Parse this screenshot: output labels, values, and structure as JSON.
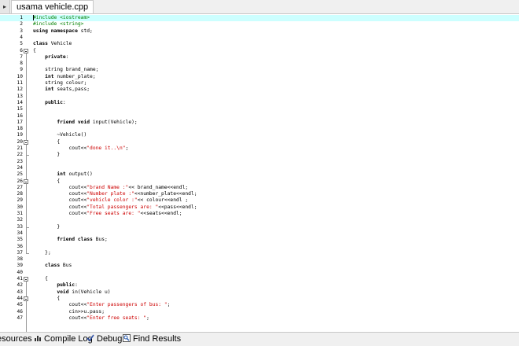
{
  "tab_bar": {
    "file_tab": "usama vehicle.cpp",
    "scroll_glyph": "▸"
  },
  "editor": {
    "lines": [
      {
        "n": "1",
        "t": [
          [
            "#include <iostream>",
            "pp"
          ]
        ]
      },
      {
        "n": "2",
        "t": [
          [
            "#include <string>",
            "pp"
          ]
        ]
      },
      {
        "n": "3",
        "t": [
          [
            "using namespace",
            "kw"
          ],
          [
            " std;",
            ""
          ]
        ]
      },
      {
        "n": "4",
        "t": []
      },
      {
        "n": "5",
        "t": [
          [
            "class",
            "kw"
          ],
          [
            " Vehicle",
            ""
          ]
        ]
      },
      {
        "n": "6",
        "t": [
          [
            "{",
            ""
          ]
        ]
      },
      {
        "n": "7",
        "t": [
          [
            "    ",
            ""
          ],
          [
            "private",
            "kw"
          ],
          [
            ":",
            ""
          ]
        ]
      },
      {
        "n": "8",
        "t": []
      },
      {
        "n": "9",
        "t": [
          [
            "    string brand_name;",
            ""
          ]
        ]
      },
      {
        "n": "10",
        "t": [
          [
            "    ",
            ""
          ],
          [
            "int",
            "kw"
          ],
          [
            " number_plate;",
            ""
          ]
        ]
      },
      {
        "n": "11",
        "t": [
          [
            "    string colour;",
            ""
          ]
        ]
      },
      {
        "n": "12",
        "t": [
          [
            "    ",
            ""
          ],
          [
            "int",
            "kw"
          ],
          [
            " seats,pass;",
            ""
          ]
        ]
      },
      {
        "n": "13",
        "t": []
      },
      {
        "n": "14",
        "t": [
          [
            "    ",
            ""
          ],
          [
            "public",
            "kw"
          ],
          [
            ":",
            ""
          ]
        ]
      },
      {
        "n": "15",
        "t": []
      },
      {
        "n": "16",
        "t": []
      },
      {
        "n": "17",
        "t": [
          [
            "        ",
            ""
          ],
          [
            "friend void",
            "kw"
          ],
          [
            " input(Vehicle);",
            ""
          ]
        ]
      },
      {
        "n": "18",
        "t": []
      },
      {
        "n": "19",
        "t": [
          [
            "        ~Vehicle()",
            ""
          ]
        ]
      },
      {
        "n": "20",
        "t": [
          [
            "        {",
            ""
          ]
        ]
      },
      {
        "n": "21",
        "t": [
          [
            "            cout<<",
            ""
          ],
          [
            "\"done it..\\n\"",
            "str"
          ],
          [
            ";",
            ""
          ]
        ]
      },
      {
        "n": "22",
        "t": [
          [
            "        }",
            ""
          ]
        ]
      },
      {
        "n": "23",
        "t": []
      },
      {
        "n": "24",
        "t": []
      },
      {
        "n": "25",
        "t": [
          [
            "        ",
            ""
          ],
          [
            "int",
            "kw"
          ],
          [
            " output()",
            ""
          ]
        ]
      },
      {
        "n": "26",
        "t": [
          [
            "        {",
            ""
          ]
        ]
      },
      {
        "n": "27",
        "t": [
          [
            "            cout<<",
            ""
          ],
          [
            "\"brand Name :\"",
            "str"
          ],
          [
            "<< brand_name<<endl;",
            ""
          ]
        ]
      },
      {
        "n": "28",
        "t": [
          [
            "            cout<<",
            ""
          ],
          [
            "\"Number plate :\"",
            "str"
          ],
          [
            "<<number_plate<<endl;",
            ""
          ]
        ]
      },
      {
        "n": "29",
        "t": [
          [
            "            cout<<",
            ""
          ],
          [
            "\"vehicle color :\"",
            "str"
          ],
          [
            "<< colour<<endl ;",
            ""
          ]
        ]
      },
      {
        "n": "30",
        "t": [
          [
            "            cout<<",
            ""
          ],
          [
            "\"Total passengers are: \"",
            "str"
          ],
          [
            "<<pass<<endl;",
            ""
          ]
        ]
      },
      {
        "n": "31",
        "t": [
          [
            "            cout<<",
            ""
          ],
          [
            "\"Free seats are: \"",
            "str"
          ],
          [
            "<<seats<<endl;",
            ""
          ]
        ]
      },
      {
        "n": "32",
        "t": []
      },
      {
        "n": "33",
        "t": [
          [
            "        }",
            ""
          ]
        ]
      },
      {
        "n": "34",
        "t": []
      },
      {
        "n": "35",
        "t": [
          [
            "        ",
            ""
          ],
          [
            "friend class",
            "kw"
          ],
          [
            " Bus;",
            ""
          ]
        ]
      },
      {
        "n": "36",
        "t": []
      },
      {
        "n": "37",
        "t": [
          [
            "    };",
            ""
          ]
        ]
      },
      {
        "n": "38",
        "t": []
      },
      {
        "n": "39",
        "t": [
          [
            "    ",
            ""
          ],
          [
            "class",
            "kw"
          ],
          [
            " Bus",
            ""
          ]
        ]
      },
      {
        "n": "40",
        "t": []
      },
      {
        "n": "41",
        "t": [
          [
            "    {",
            ""
          ]
        ]
      },
      {
        "n": "42",
        "t": [
          [
            "        ",
            ""
          ],
          [
            "public",
            "kw"
          ],
          [
            ":",
            ""
          ]
        ]
      },
      {
        "n": "43",
        "t": [
          [
            "        ",
            ""
          ],
          [
            "void",
            "kw"
          ],
          [
            " in(Vehicle u)",
            ""
          ]
        ]
      },
      {
        "n": "44",
        "t": [
          [
            "        {",
            ""
          ]
        ]
      },
      {
        "n": "45",
        "t": [
          [
            "            cout<<",
            ""
          ],
          [
            "\"Enter passengers of bus: \"",
            "str"
          ],
          [
            ";",
            ""
          ]
        ]
      },
      {
        "n": "46",
        "t": [
          [
            "            cin>>u.pass;",
            ""
          ]
        ]
      },
      {
        "n": "47",
        "t": [
          [
            "            cout<<",
            ""
          ],
          [
            "\"Enter free seats: \"",
            "str"
          ],
          [
            ";",
            ""
          ]
        ]
      }
    ]
  },
  "bottom_bar": {
    "tabs": [
      {
        "label": "esources",
        "icon": "resources-icon"
      },
      {
        "label": "Compile Log",
        "icon": "compile-log-icon"
      },
      {
        "label": "Debug",
        "icon": "debug-check-icon"
      },
      {
        "label": "Find Results",
        "icon": "find-results-icon"
      }
    ]
  },
  "colors": {
    "current_line": "#ccffff",
    "string": "#cc0000",
    "preprocessor": "#008000"
  }
}
